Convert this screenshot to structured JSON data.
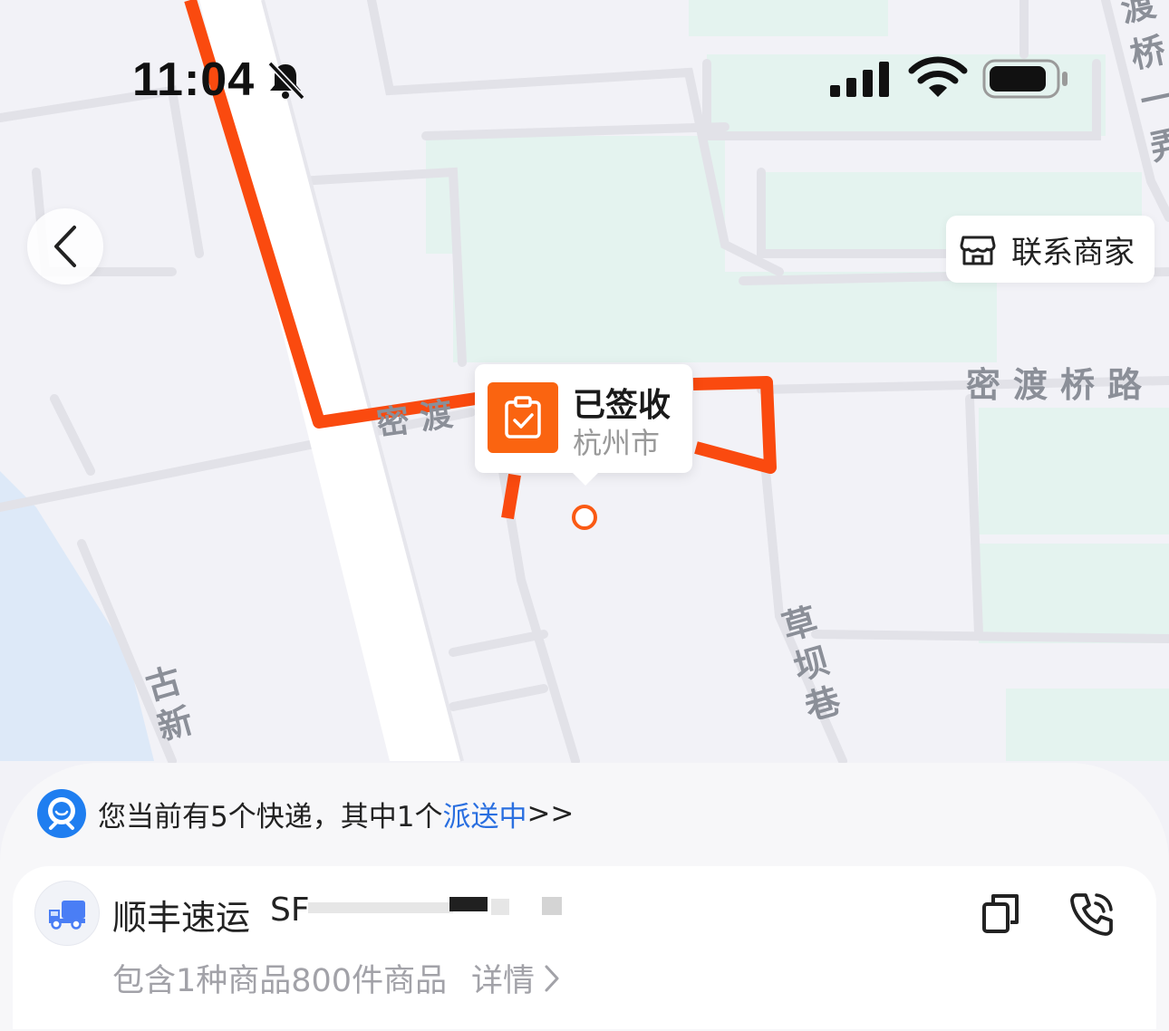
{
  "status_bar": {
    "time": "11:04",
    "icons": [
      "bell-slash-icon",
      "signal-icon",
      "wifi-icon",
      "battery-icon"
    ]
  },
  "header": {
    "back_icon": "chevron-left-icon",
    "contact_merchant_label": "联系商家",
    "contact_merchant_icon": "store-icon"
  },
  "map": {
    "route_color": "#fa4a0f",
    "road_labels": {
      "midu_bridge_road": "密渡桥路",
      "midu_partial": "密渡",
      "caoba_lane": "草坝巷",
      "guxin": "古新",
      "dubridge": "渡桥一弄"
    }
  },
  "status_popup": {
    "title": "已签收",
    "city": "杭州市",
    "icon": "clipboard-check-icon",
    "accent_color": "#fa6410"
  },
  "notice": {
    "icon": "robot-assistant-icon",
    "text": "您当前有5个快递，其中1个",
    "link_text": "派送中",
    "arrow": ">>",
    "link_color": "#2a6fe0"
  },
  "shipment": {
    "carrier_icon": "truck-icon",
    "carrier_name": "顺丰速运",
    "tracking_prefix": "SF",
    "goods_summary": "包含1种商品800件商品",
    "detail_label": "详情",
    "detail_icon": "chevron-right-icon",
    "copy_icon": "copy-icon",
    "phone_icon": "phone-icon"
  }
}
